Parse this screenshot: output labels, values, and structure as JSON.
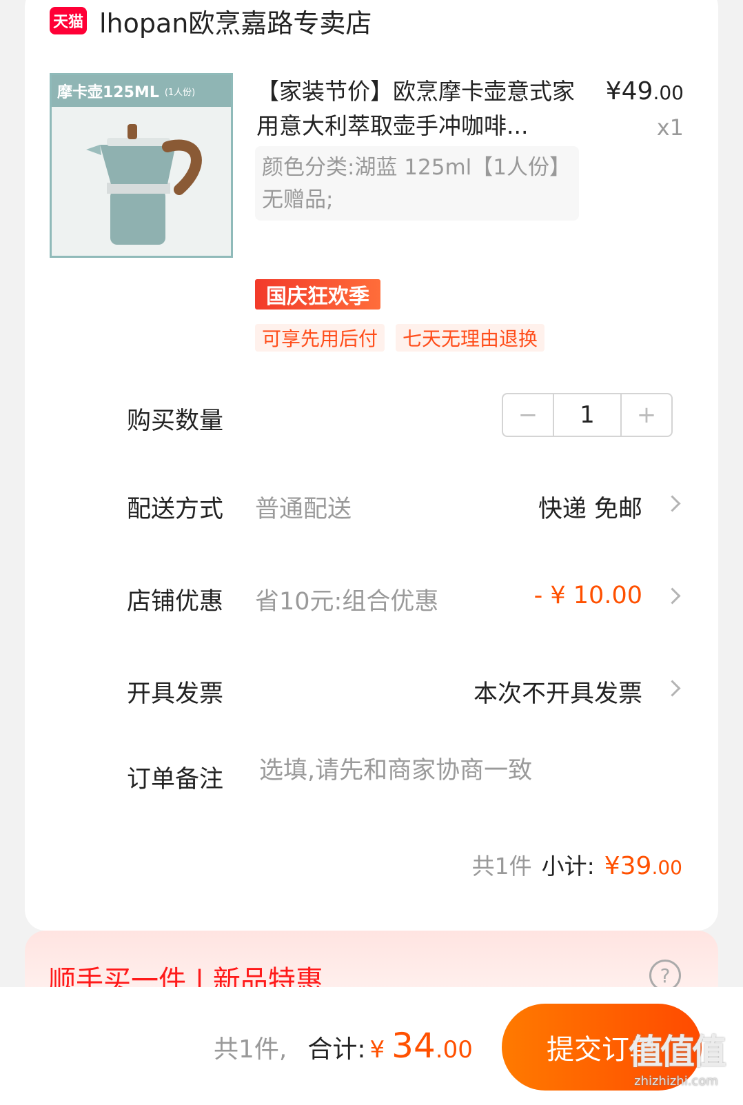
{
  "store": {
    "badge": "天猫",
    "name": "lhopan欧烹嘉路专卖店"
  },
  "product": {
    "thumb_label": "摩卡壶125ML",
    "thumb_sub": "(1人份)",
    "title": "【家装节价】欧烹摩卡壶意式家用意大利萃取壶手冲咖啡...",
    "price_currency": "¥",
    "price_int": "49",
    "price_dec": ".00",
    "quantity_text": "x1",
    "sku": "颜色分类:湖蓝 125ml【1人份】无赠品;",
    "promo_tag": "国庆狂欢季",
    "services": [
      "可享先用后付",
      "七天无理由退换"
    ]
  },
  "quantity": {
    "label": "购买数量",
    "value": "1",
    "minus": "−",
    "plus": "+"
  },
  "delivery": {
    "label": "配送方式",
    "sub": "普通配送",
    "value": "快递 免邮"
  },
  "discount": {
    "label": "店铺优惠",
    "sub": "省10元:组合优惠",
    "value": "- ¥ 10.00"
  },
  "invoice": {
    "label": "开具发票",
    "value": "本次不开具发票"
  },
  "remark": {
    "label": "订单备注",
    "placeholder": "选填,请先和商家协商一致"
  },
  "subtotal": {
    "count": "共1件",
    "label": "小计:",
    "currency": "¥",
    "int": "39",
    "dec": ".00"
  },
  "addon": {
    "title": "顺手买一件 | 新品特惠",
    "help": "?"
  },
  "footer": {
    "count": "共1件,",
    "label": "合计:",
    "currency": "¥",
    "int": "34",
    "dec": ".00",
    "submit": "提交订单"
  },
  "watermark": {
    "logo": "值值值",
    "url": "zhizhizhi.com"
  },
  "colors": {
    "accent": "#ff5000",
    "tmall": "#ff0036",
    "promo": "#f23a2a"
  }
}
